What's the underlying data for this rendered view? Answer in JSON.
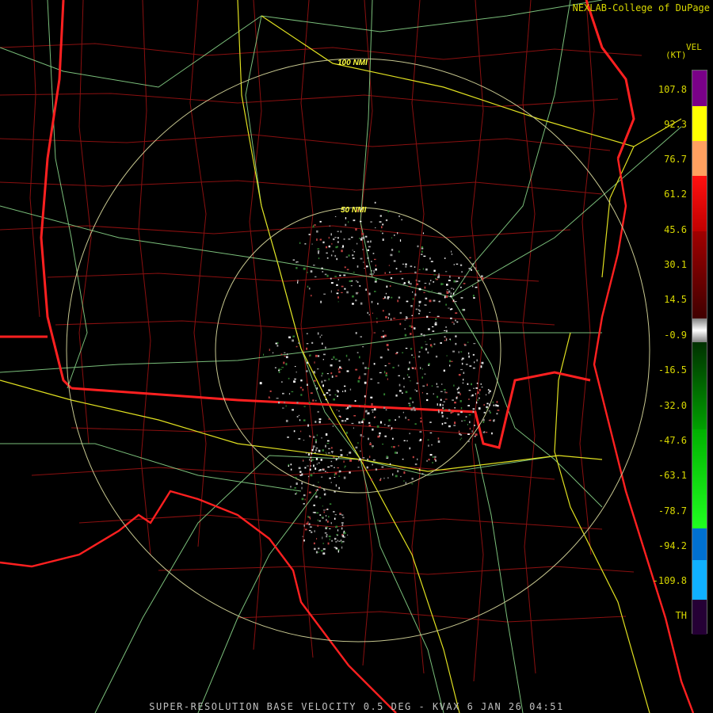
{
  "header": {
    "credit": "NEXLAB-College of DuPage"
  },
  "legend": {
    "unit_top": "VEL",
    "unit": "(KT)",
    "ticks": [
      "107.8",
      "92.3",
      "76.7",
      "61.2",
      "45.6",
      "30.1",
      "14.5",
      "-0.9",
      "-16.5",
      "-32.0",
      "-47.6",
      "-63.1",
      "-78.7",
      "-94.2",
      "-109.8",
      "TH"
    ]
  },
  "map": {
    "range_rings": [
      "50 NMI",
      "100 NMI"
    ]
  },
  "footer": {
    "caption": "SUPER-RESOLUTION BASE VELOCITY 0.5 DEG - KVAX 6 JAN 26 04:51"
  }
}
